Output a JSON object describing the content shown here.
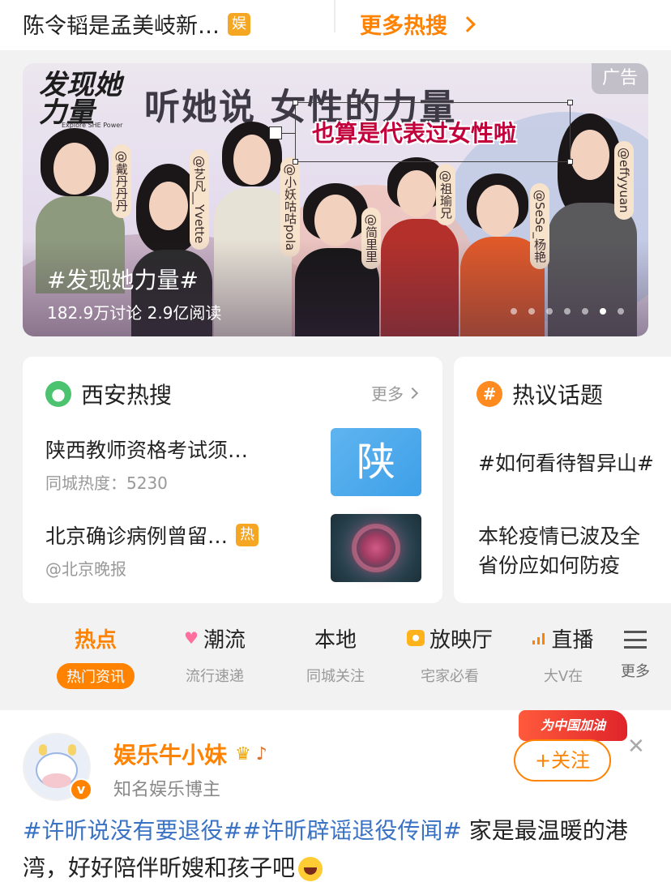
{
  "top_strip": {
    "hot_item": "陈令韬是孟美岐新…",
    "hot_item_badge": "娱",
    "more_hot_search": "更多热搜"
  },
  "banner": {
    "logo": "发现她力量",
    "logo_sub": "Explore SHE Power",
    "slogan": "听她说 女性的力量",
    "ad_label": "广告",
    "quote": "也算是代表过女性啦",
    "people": [
      "@戴丹丹丹",
      "@艺凡__Yvette",
      "@小妖咕咕pola",
      "@简里里",
      "@祖瑜兄",
      "@SeSe_杨艳",
      "@effyyuan"
    ],
    "topic": "#发现她力量#",
    "stats": "182.9万讨论  2.9亿阅读",
    "carousel_total": 7,
    "carousel_active_index": 5
  },
  "local_card": {
    "title": "西安热搜",
    "more": "更多",
    "items": [
      {
        "title": "陕西教师资格考试须…",
        "meta": "同城热度：5230",
        "thumb_text": "陕"
      },
      {
        "title": "北京确诊病例曾留…",
        "badge": "热",
        "meta": "@北京晚报"
      }
    ]
  },
  "topics_card": {
    "title": "热议话题",
    "line1": "#如何看待智异山#",
    "line2": "本轮疫情已波及全",
    "line3": "省份应如何防疫"
  },
  "tabs": [
    {
      "label": "热点",
      "sub": "热门资讯",
      "active": true
    },
    {
      "label": "潮流",
      "sub": "流行速递",
      "icon": "heart-icon"
    },
    {
      "label": "本地",
      "sub": "同城关注"
    },
    {
      "label": "放映厅",
      "sub": "宅家必看",
      "icon": "tv-icon"
    },
    {
      "label": "直播",
      "sub": "大V在",
      "icon": "signal-bars-icon"
    }
  ],
  "tab_more": {
    "sub": "更多"
  },
  "post": {
    "author": "娱乐牛小妹",
    "author_desc": "知名娱乐博主",
    "verified_mark": "v",
    "promo_tag": "为中国加油",
    "follow": "+关注",
    "hashtag1": "#许昕说没有要退役#",
    "hashtag2": "#许昕辟谣退役传闻#",
    "text": " 家是最温暖的港湾，好好陪伴昕嫂和孩子吧"
  },
  "colors": {
    "accent": "#ff8200",
    "hashtag": "#3a72c4",
    "quote_red": "#c2003b"
  }
}
